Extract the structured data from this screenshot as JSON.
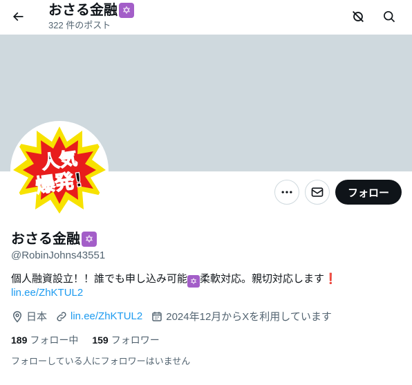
{
  "header": {
    "title": "おさる金融",
    "post_count": "322 件のポスト"
  },
  "profile": {
    "name": "おさる金融",
    "handle": "@RobinJohns43551",
    "bio_part1": "個人融資設立！！誰でも申し込み可能",
    "bio_part2": "柔軟対応。親切対応します",
    "bio_link": "lin.ee/ZhKTUL2",
    "location": "日本",
    "website": "lin.ee/ZhKTUL2",
    "joined": "2024年12月からXを利用しています",
    "following_count": "189",
    "following_label": "フォロー中",
    "followers_count": "159",
    "followers_label": "フォロワー",
    "followed_by_text": "フォローしている人にフォロワーはいません",
    "avatar_text_top": "人気",
    "avatar_text_bottom": "爆発!"
  },
  "actions": {
    "follow_label": "フォロー"
  },
  "icons": {
    "back": "arrow-left-icon",
    "grok": "grok-icon",
    "search": "search-icon",
    "more": "more-icon",
    "message": "mail-icon",
    "location": "location-pin-icon",
    "link": "link-icon",
    "calendar": "calendar-icon",
    "star": "six-pointed-star-icon"
  },
  "colors": {
    "banner": "#cfd9de",
    "link": "#1d9bf0",
    "follow_button": "#0f1419",
    "star_badge": "#a35ec8"
  }
}
